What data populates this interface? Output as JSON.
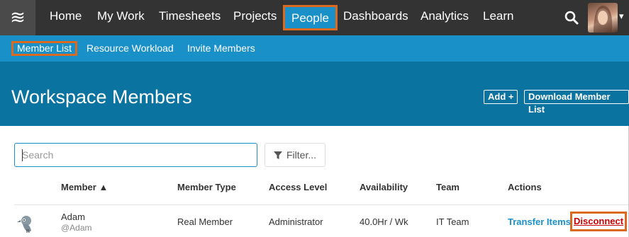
{
  "topnav": {
    "logo_glyph": "≋",
    "items": [
      {
        "label": "Home"
      },
      {
        "label": "My Work"
      },
      {
        "label": "Timesheets"
      },
      {
        "label": "Projects"
      },
      {
        "label": "People"
      },
      {
        "label": "Dashboards"
      },
      {
        "label": "Analytics"
      },
      {
        "label": "Learn"
      }
    ],
    "active_index": 4,
    "search_icon": "search-icon",
    "avatar_icon": "user-avatar",
    "dropdown_glyph": "▾"
  },
  "subnav": {
    "items": [
      {
        "label": "Member List"
      },
      {
        "label": "Resource Workload"
      },
      {
        "label": "Invite Members"
      }
    ],
    "active_index": 0
  },
  "header": {
    "title": "Workspace Members",
    "add_label": "Add +",
    "download_label": "Download Member List"
  },
  "search": {
    "placeholder": "Search",
    "value": ""
  },
  "filter": {
    "label": "Filter...",
    "icon": "filter-funnel-icon"
  },
  "table": {
    "columns": [
      "Member ▲",
      "Member Type",
      "Access Level",
      "Availability",
      "Team",
      "Actions"
    ],
    "rows": [
      {
        "name": "Adam",
        "handle": "@Adam",
        "member_type": "Real Member",
        "access_level": "Administrator",
        "availability": "40.0Hr / Wk",
        "team": "IT Team",
        "transfer_label": "Transfer Items",
        "disconnect_label": "Disconnect"
      }
    ]
  },
  "colors": {
    "topnav_bg": "#333333",
    "accent_blue": "#1a90c8",
    "header_bg": "#0b73a0",
    "highlight_orange": "#d96a1f",
    "disconnect_red": "#cc0000"
  }
}
